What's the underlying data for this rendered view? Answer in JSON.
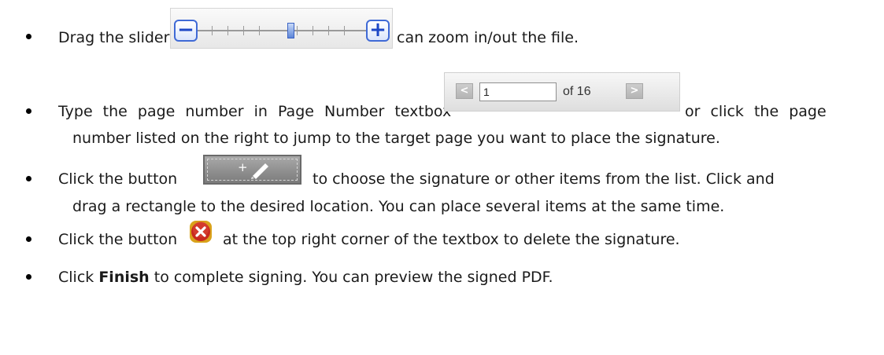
{
  "items": [
    {
      "before": "Drag the slider",
      "after": "can zoom in/out the file."
    },
    {
      "before": "Type the page number in Page Number textbox",
      "after": "or click the page",
      "line2": "number listed on the right to jump to the target page you want to place the signature."
    },
    {
      "before": "Click the button",
      "after": "to choose the signature or other items from the list. Click and",
      "line2": "drag a rectangle to the desired location. You can place several items at the same time."
    },
    {
      "before": "Click the button",
      "after": "at the top right corner of the textbox to delete the signature."
    },
    {
      "before": "Click ",
      "bold": "Finish",
      "after": " to complete signing. You can preview the signed PDF."
    }
  ],
  "slider": {
    "minus_symbol": "−",
    "plus_symbol": "+",
    "level_percent": 55
  },
  "pager": {
    "prev_symbol": "<",
    "page_value": "1",
    "of_text": "of 16",
    "next_symbol": ">"
  },
  "add_button": {
    "plus_symbol": "+",
    "icon": "pencil-icon"
  },
  "delete_button": {
    "icon": "close-icon",
    "color": "#c8281e"
  }
}
